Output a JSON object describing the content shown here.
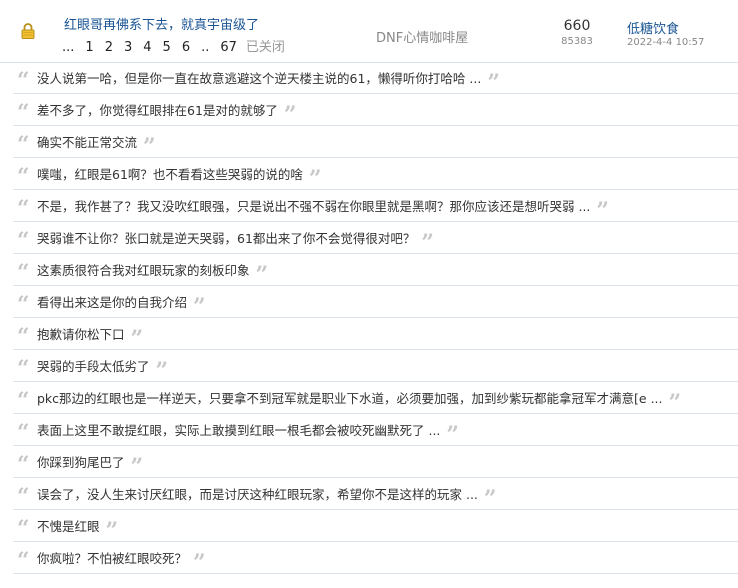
{
  "thread": {
    "title": "红眼哥再佛系下去，就真宇宙级了",
    "pages": [
      "...",
      "1",
      "2",
      "3",
      "4",
      "5",
      "6",
      "..",
      "67"
    ],
    "closed_label": "已关闭",
    "forum": "DNF心情咖啡屋",
    "replies": "660",
    "views": "85383",
    "author": "低糖饮食",
    "date": "2022-4-4 10:57",
    "lock_icon": "lock-icon"
  },
  "replies": [
    "没人说第一哈，但是你一直在故意逃避这个逆天楼主说的61，懒得听你打哈哈 ...",
    "差不多了，你觉得红眼排在61是对的就够了",
    "确实不能正常交流",
    "噗嗤，红眼是61啊？也不看看这些哭弱的说的啥",
    "不是，我作甚了？我又没吹红眼强，只是说出不强不弱在你眼里就是黑啊？那你应该还是想听哭弱 ...",
    "哭弱谁不让你？张口就是逆天哭弱，61都出来了你不会觉得很对吧？",
    "这素质很符合我对红眼玩家的刻板印象",
    "看得出来这是你的自我介绍",
    "抱歉请你松下口",
    "哭弱的手段太低劣了",
    "pkc那边的红眼也是一样逆天，只要拿不到冠军就是职业下水道，必须要加强，加到纱紫玩都能拿冠军才满意[e ...",
    "表面上这里不敢提红眼，实际上敢摸到红眼一根毛都会被咬死幽默死了 ...",
    "你踩到狗尾巴了",
    "误会了，没人生来讨厌红眼，而是讨厌这种红眼玩家，希望你不是这样的玩家 ...",
    "不愧是红眼",
    "你疯啦？不怕被红眼咬死？"
  ],
  "colors": {
    "link": "#1a5494",
    "quote": "#c8c8c8",
    "divider": "#dbe4ee"
  }
}
